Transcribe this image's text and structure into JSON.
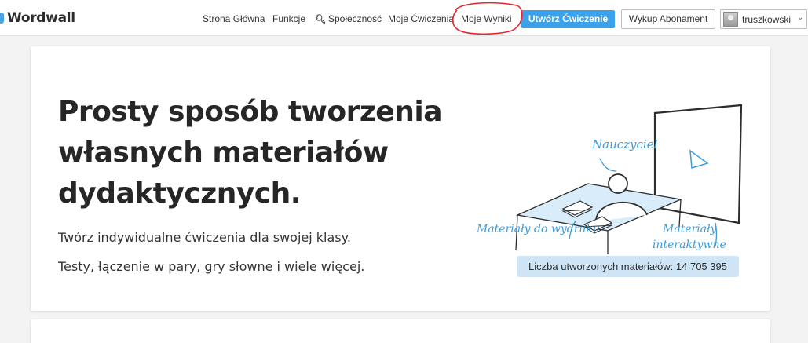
{
  "header": {
    "logo": "Wordwall",
    "nav": {
      "home": "Strona Główna",
      "features": "Funkcje",
      "community": "Społeczność",
      "my_activities": "Moje Ćwiczenia",
      "my_results": "Moje Wyniki"
    },
    "create_button": "Utwórz Ćwiczenie",
    "subscribe_button": "Wykup Abonament",
    "username": "truszkowski"
  },
  "hero": {
    "title": "Prosty sposób tworzenia własnych materiałów dydaktycznych.",
    "line1": "Twórz indywidualne ćwiczenia dla swojej klasy.",
    "line2": "Testy, łączenie w pary, gry słowne i wiele więcej."
  },
  "illustration": {
    "teacher_label": "Nauczyciel",
    "printables_label": "Materiały do wydruku",
    "interactive_label_1": "Materiały",
    "interactive_label_2": "interaktywne"
  },
  "counter": "Liczba utworzonych materiałów: 14 705 395",
  "colors": {
    "accent": "#3aa1ea",
    "annotation": "#e8262a",
    "counter_bg": "#cfe5f6"
  }
}
